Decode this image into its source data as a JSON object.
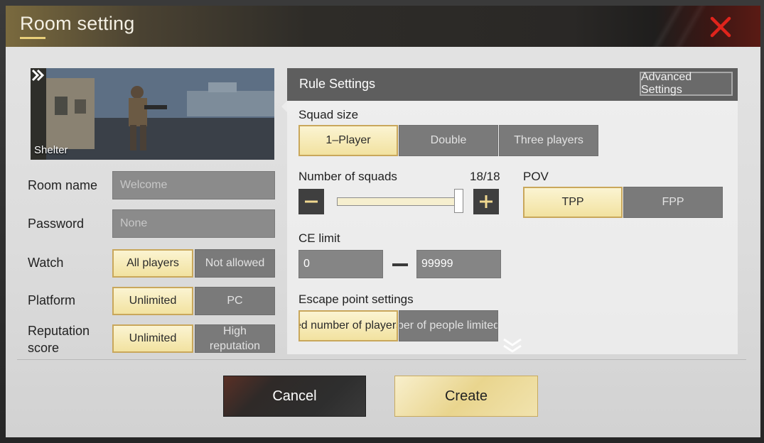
{
  "dialog": {
    "title": "Room setting"
  },
  "map": {
    "name": "Shelter"
  },
  "form": {
    "room_name": {
      "label": "Room name",
      "placeholder": "Welcome"
    },
    "password": {
      "label": "Password",
      "placeholder": "None"
    },
    "watch": {
      "label": "Watch",
      "options": [
        "All players",
        "Not allowed"
      ],
      "selected": "All players"
    },
    "platform": {
      "label": "Platform",
      "options": [
        "Unlimited",
        "PC"
      ],
      "selected": "Unlimited"
    },
    "reputation": {
      "label_line1": "Reputation",
      "label_line2": "score",
      "options": [
        "Unlimited"
      ],
      "high_line1": "High",
      "high_line2": "reputation",
      "selected": "Unlimited"
    }
  },
  "rules": {
    "title": "Rule Settings",
    "advanced_label": "Advanced Settings",
    "squad_size": {
      "label": "Squad size",
      "options": [
        "1–Player",
        "Double",
        "Three players"
      ],
      "selected": "1–Player"
    },
    "squads": {
      "label": "Number of squads",
      "value_text": "18/18",
      "value": 18,
      "max": 18
    },
    "pov": {
      "label": "POV",
      "options": [
        "TPP",
        "FPP"
      ],
      "selected": "TPP"
    },
    "ce_limit": {
      "label": "CE limit",
      "min": "0",
      "max": "99999"
    },
    "escape": {
      "label": "Escape point settings",
      "options": [
        "ed number of players",
        "ber of people limited"
      ],
      "selected": "ed number of players"
    }
  },
  "footer": {
    "cancel_label": "Cancel",
    "create_label": "Create"
  },
  "colors": {
    "accent_gold": "#f2e2a0",
    "close_red": "#e0241c"
  }
}
